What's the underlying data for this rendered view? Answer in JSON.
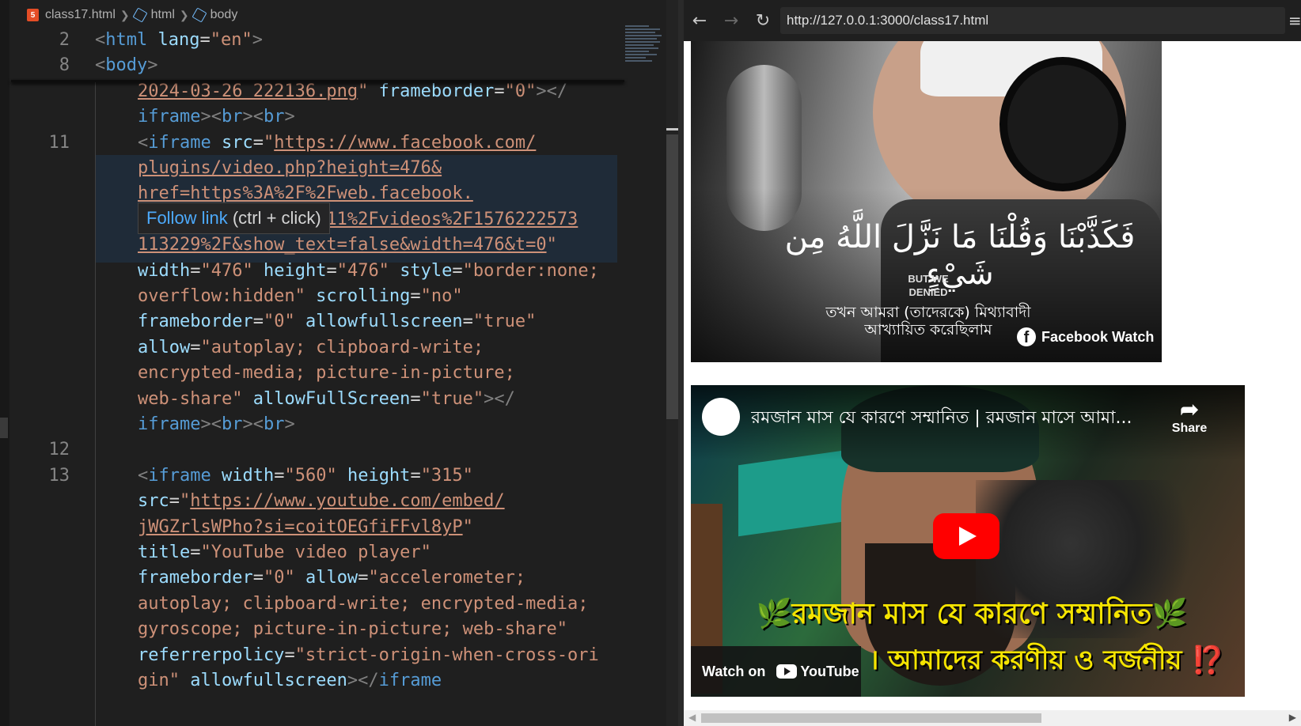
{
  "editor": {
    "breadcrumb": {
      "file": "class17.html",
      "crumb1": "html",
      "crumb2": "body",
      "file_icon": "5"
    },
    "sticky": [
      {
        "num": "2",
        "parts": [
          [
            "t-punc",
            "<"
          ],
          [
            "t-tag",
            "html"
          ],
          [
            "t-eq",
            " "
          ],
          [
            "t-attr",
            "lang"
          ],
          [
            "t-eq",
            "="
          ],
          [
            "t-str",
            "\"en\""
          ],
          [
            "t-punc",
            ">"
          ]
        ]
      },
      {
        "num": "8",
        "parts": [
          [
            "t-punc",
            "<"
          ],
          [
            "t-tag",
            "body"
          ],
          [
            "t-punc",
            ">"
          ]
        ]
      }
    ],
    "lines": [
      {
        "num": "",
        "parts": [
          [
            "t-str link",
            "2024-03-26 222136.png"
          ],
          [
            "t-str",
            "\""
          ],
          [
            "t-eq",
            " "
          ],
          [
            "t-attr",
            "frameborder"
          ],
          [
            "t-eq",
            "="
          ],
          [
            "t-str",
            "\"0\""
          ],
          [
            "t-punc",
            "></"
          ]
        ]
      },
      {
        "num": "",
        "parts": [
          [
            "t-tag",
            "iframe"
          ],
          [
            "t-punc",
            ">"
          ],
          [
            "t-punc",
            "<"
          ],
          [
            "t-tag",
            "br"
          ],
          [
            "t-punc",
            ">"
          ],
          [
            "t-punc",
            "<"
          ],
          [
            "t-tag",
            "br"
          ],
          [
            "t-punc",
            ">"
          ]
        ]
      },
      {
        "num": "11",
        "parts": [
          [
            "t-punc",
            "<"
          ],
          [
            "t-tag",
            "iframe"
          ],
          [
            "t-eq",
            " "
          ],
          [
            "t-attr",
            "src"
          ],
          [
            "t-eq",
            "="
          ],
          [
            "t-str",
            "\""
          ],
          [
            "t-str link",
            "https://www.facebook.com/"
          ]
        ]
      },
      {
        "num": "",
        "parts": [
          [
            "t-str link",
            "plugins/video.php?height=476&"
          ]
        ]
      },
      {
        "num": "",
        "parts": [
          [
            "t-str link",
            "href=https%3A%2F%2Fweb.facebook."
          ]
        ]
      },
      {
        "num": "",
        "parts": [
          [
            "t-eq",
            "                  "
          ],
          [
            "t-str link",
            "11%2Fvideos%2F1576222573"
          ]
        ]
      },
      {
        "num": "",
        "parts": [
          [
            "t-str link",
            "113229%2F&show_text=false&width=476&t=0"
          ],
          [
            "t-str",
            "\""
          ]
        ]
      },
      {
        "num": "",
        "parts": [
          [
            "t-attr",
            "width"
          ],
          [
            "t-eq",
            "="
          ],
          [
            "t-str",
            "\"476\""
          ],
          [
            "t-eq",
            " "
          ],
          [
            "t-attr",
            "height"
          ],
          [
            "t-eq",
            "="
          ],
          [
            "t-str",
            "\"476\""
          ],
          [
            "t-eq",
            " "
          ],
          [
            "t-attr",
            "style"
          ],
          [
            "t-eq",
            "="
          ],
          [
            "t-str",
            "\"border:none;"
          ]
        ]
      },
      {
        "num": "",
        "parts": [
          [
            "t-str",
            "overflow:hidden\""
          ],
          [
            "t-eq",
            " "
          ],
          [
            "t-attr",
            "scrolling"
          ],
          [
            "t-eq",
            "="
          ],
          [
            "t-str",
            "\"no\""
          ]
        ]
      },
      {
        "num": "",
        "parts": [
          [
            "t-attr",
            "frameborder"
          ],
          [
            "t-eq",
            "="
          ],
          [
            "t-str",
            "\"0\""
          ],
          [
            "t-eq",
            " "
          ],
          [
            "t-attr",
            "allowfullscreen"
          ],
          [
            "t-eq",
            "="
          ],
          [
            "t-str",
            "\"true\""
          ]
        ]
      },
      {
        "num": "",
        "parts": [
          [
            "t-attr",
            "allow"
          ],
          [
            "t-eq",
            "="
          ],
          [
            "t-str",
            "\"autoplay; clipboard-write;"
          ]
        ]
      },
      {
        "num": "",
        "parts": [
          [
            "t-str",
            "encrypted-media; picture-in-picture;"
          ]
        ]
      },
      {
        "num": "",
        "parts": [
          [
            "t-str",
            "web-share\""
          ],
          [
            "t-eq",
            " "
          ],
          [
            "t-attr",
            "allowFullScreen"
          ],
          [
            "t-eq",
            "="
          ],
          [
            "t-str",
            "\"true\""
          ],
          [
            "t-punc",
            "></"
          ]
        ]
      },
      {
        "num": "",
        "parts": [
          [
            "t-tag",
            "iframe"
          ],
          [
            "t-punc",
            ">"
          ],
          [
            "t-punc",
            "<"
          ],
          [
            "t-tag",
            "br"
          ],
          [
            "t-punc",
            ">"
          ],
          [
            "t-punc",
            "<"
          ],
          [
            "t-tag",
            "br"
          ],
          [
            "t-punc",
            ">"
          ]
        ]
      },
      {
        "num": "12",
        "parts": []
      },
      {
        "num": "13",
        "parts": [
          [
            "t-punc",
            "<"
          ],
          [
            "t-tag",
            "iframe"
          ],
          [
            "t-eq",
            " "
          ],
          [
            "t-attr",
            "width"
          ],
          [
            "t-eq",
            "="
          ],
          [
            "t-str",
            "\"560\""
          ],
          [
            "t-eq",
            " "
          ],
          [
            "t-attr",
            "height"
          ],
          [
            "t-eq",
            "="
          ],
          [
            "t-str",
            "\"315\""
          ]
        ]
      },
      {
        "num": "",
        "parts": [
          [
            "t-attr",
            "src"
          ],
          [
            "t-eq",
            "="
          ],
          [
            "t-str",
            "\""
          ],
          [
            "t-str link",
            "https://www.youtube.com/embed/"
          ]
        ]
      },
      {
        "num": "",
        "parts": [
          [
            "t-str link",
            "jWGZrlsWPho?si=coitOEGfiFFvl8yP"
          ],
          [
            "t-str",
            "\""
          ]
        ]
      },
      {
        "num": "",
        "parts": [
          [
            "t-attr",
            "title"
          ],
          [
            "t-eq",
            "="
          ],
          [
            "t-str",
            "\"YouTube video player\""
          ]
        ]
      },
      {
        "num": "",
        "parts": [
          [
            "t-attr",
            "frameborder"
          ],
          [
            "t-eq",
            "="
          ],
          [
            "t-str",
            "\"0\""
          ],
          [
            "t-eq",
            " "
          ],
          [
            "t-attr",
            "allow"
          ],
          [
            "t-eq",
            "="
          ],
          [
            "t-str",
            "\"accelerometer;"
          ]
        ]
      },
      {
        "num": "",
        "parts": [
          [
            "t-str",
            "autoplay; clipboard-write; encrypted-media;"
          ]
        ]
      },
      {
        "num": "",
        "parts": [
          [
            "t-str",
            "gyroscope; picture-in-picture; web-share\""
          ]
        ]
      },
      {
        "num": "",
        "parts": [
          [
            "t-attr",
            "referrerpolicy"
          ],
          [
            "t-eq",
            "="
          ],
          [
            "t-str",
            "\"strict-origin-when-cross-ori"
          ]
        ]
      },
      {
        "num": "",
        "parts": [
          [
            "t-str",
            "gin\""
          ],
          [
            "t-eq",
            " "
          ],
          [
            "t-attr",
            "allowfullscreen"
          ],
          [
            "t-punc",
            "></"
          ],
          [
            "t-tag",
            "iframe"
          ]
        ]
      }
    ],
    "tooltip": {
      "link": "Follow link",
      "hint": " (ctrl + click)"
    }
  },
  "browser": {
    "back_icon": "←",
    "forward_icon": "→",
    "reload_icon": "↻",
    "menu_icon": "≡",
    "url": "http://127.0.0.1:3000/class17.html",
    "facebook": {
      "arabic": "فَكَذَّبْنَا وَقُلْنَا مَا نَزَّلَ اللَّهُ مِن شَيْءٍ",
      "english": "BUT WE DENIED",
      "bengali_1": "তখন আমরা (তাদেরকে) মিথ্যাবাদী",
      "bengali_2": "আখ্যায়িত করেছিলাম",
      "watch_label": "Facebook Watch",
      "logo": "f"
    },
    "youtube": {
      "title": "রমজান মাস যে কারণে সম্মানিত | রমজান মাসে আমা...",
      "share": "Share",
      "share_icon": "➦",
      "headline_1": "🌿রমজান মাস যে কারণে সম্মানিত🌿",
      "headline_2": "। আমাদের করণীয় ও বর্জনীয় ⁉️",
      "watch_on": "Watch on",
      "yt_brand": "YouTube"
    }
  }
}
